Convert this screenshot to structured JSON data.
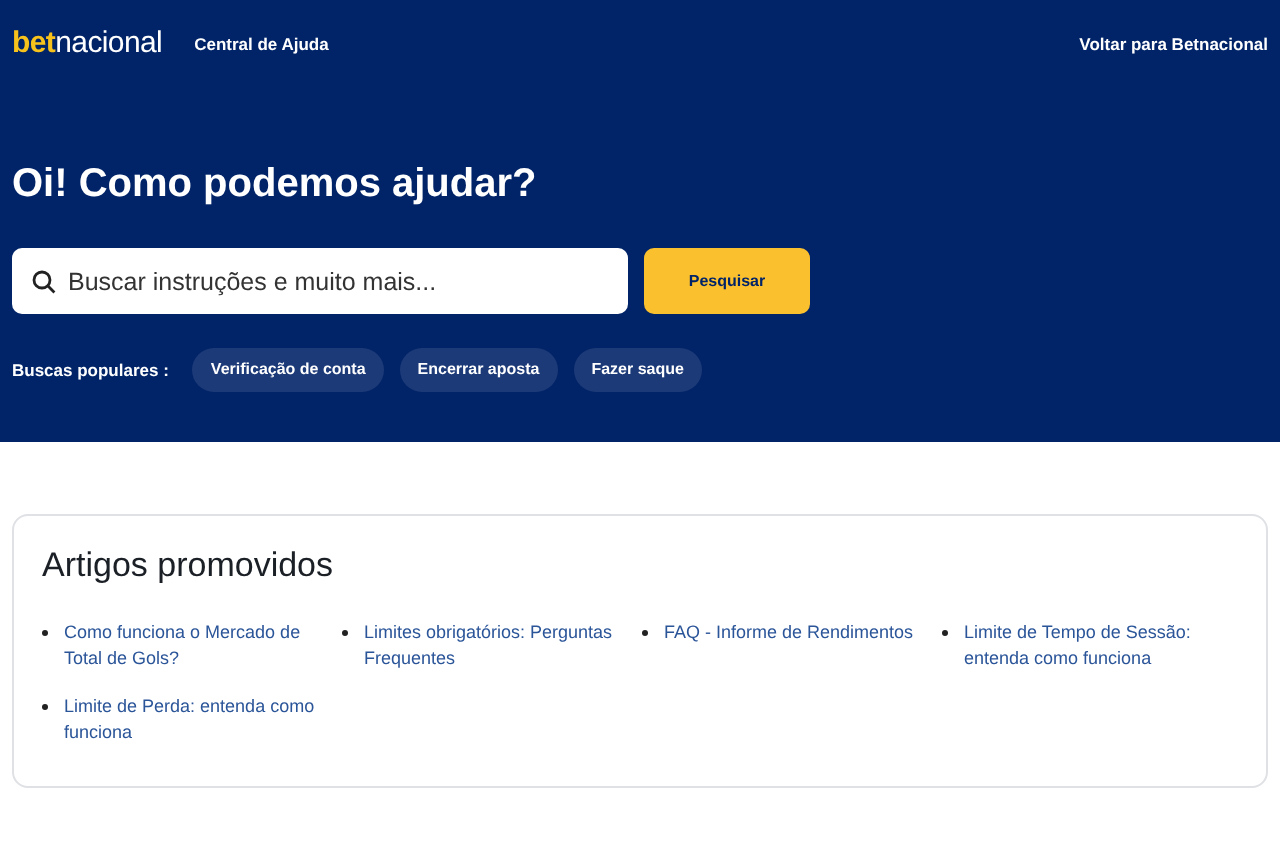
{
  "header": {
    "logo": {
      "part_1": "bet",
      "part_2": "nacional"
    },
    "section": "Central de Ajuda",
    "back_link": "Voltar para Betnacional"
  },
  "hero": {
    "title": "Oi! Como podemos ajudar?",
    "search": {
      "placeholder": "Buscar instruções e muito mais..."
    },
    "search_button": "Pesquisar",
    "popular_label": "Buscas populares :",
    "popular": [
      "Verificação de conta",
      "Encerrar aposta",
      "Fazer saque"
    ]
  },
  "promoted": {
    "title": "Artigos promovidos",
    "articles": [
      "Como funciona o Mercado de Total de Gols?",
      "Limites obrigatórios: Perguntas Frequentes",
      "FAQ - Informe de Rendimentos",
      "Limite de Tempo de Sessão: entenda como funciona",
      "Limite de Perda: entenda como funciona"
    ]
  }
}
